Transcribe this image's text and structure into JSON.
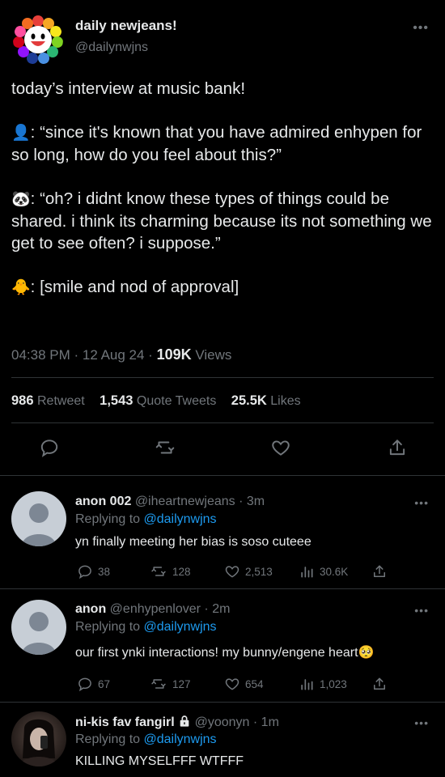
{
  "tweet": {
    "author_name": "daily newjeans!",
    "author_handle": "@dailynwjns",
    "more": "•••",
    "line1": "today’s interview at music bank!",
    "q_prefix": ": “since it's known that you have admired enhypen for so long, how do you feel about this?”",
    "a_prefix": ": “oh? i didnt know these types of things could be shared. i think its charming because its not something we get to see often? i suppose.”",
    "c_prefix": ": [smile and nod of approval]",
    "emoji_q": "👤",
    "emoji_a": "🐼",
    "emoji_c": "🐥",
    "time": "04:38 PM · 12 Aug 24 · ",
    "views_count": "109K",
    "views_label": " Views",
    "retweets_count": "986",
    "retweets_label": "Retweet",
    "quotes_count": "1,543",
    "quotes_label": "Quote Tweets",
    "likes_count": "25.5K",
    "likes_label": "Likes"
  },
  "replies": [
    {
      "name": "anon 002",
      "handle": "@iheartnewjeans · 3m",
      "replying_label": "Replying to ",
      "mention": "@dailynwjns",
      "text": "yn finally meeting her bias is soso cuteee",
      "replies": "38",
      "retweets": "128",
      "likes": "2,513",
      "views": "30.6K"
    },
    {
      "name": "anon",
      "handle": "@enhypenlover · 2m",
      "replying_label": "Replying to ",
      "mention": "@dailynwjns",
      "text": "our first ynki interactions! my bunny/engene heart🥺",
      "replies": "67",
      "retweets": "127",
      "likes": "654",
      "views": "1,023"
    },
    {
      "name": "ni-kis fav fangirl",
      "handle": "@yoonyn · 1m",
      "replying_label": "Replying to ",
      "mention": "@dailynwjns",
      "text": "KILLING MYSELFFF WTFFF"
    }
  ],
  "colors": {
    "accent": "#1d9bf0",
    "muted": "#71767b",
    "text": "#e7e9ea",
    "border": "#2f3336"
  },
  "icons": [
    "reply-icon",
    "retweet-icon",
    "like-icon",
    "share-icon",
    "views-icon",
    "lock-icon",
    "more-icon"
  ]
}
